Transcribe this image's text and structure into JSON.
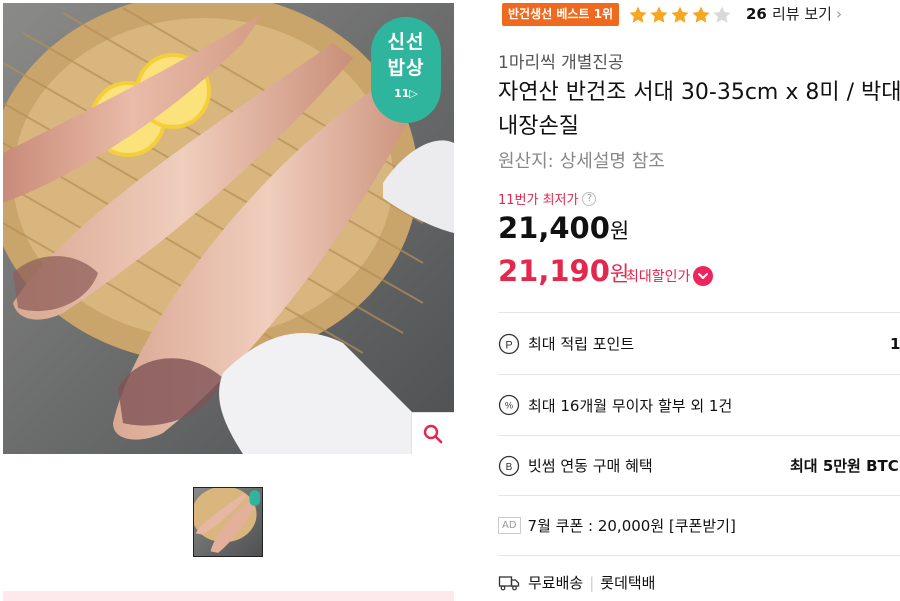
{
  "gallery": {
    "badge_line1": "신선",
    "badge_line2": "밥상",
    "badge_logo": "11▷",
    "zoom_icon": "search-icon"
  },
  "header": {
    "best_badge": "반건생선 베스트 1위",
    "rating": 4,
    "rating_max": 5,
    "review_count": "26",
    "review_link": "리뷰 보기",
    "star_color": "#f5a623"
  },
  "product": {
    "subtitle": "1마리씩 개별진공",
    "title": "자연산 반건조 서대 30-35cm x 8미 / 박대 / 내장손질",
    "origin_label": "원산지:",
    "origin_value": "상세설명 참조"
  },
  "price": {
    "lowest_label": "11번가 최저가",
    "original": "21,400",
    "original_unit": "원",
    "sale": "21,190",
    "sale_unit": "원",
    "max_discount_label": "최대할인가",
    "accent_color": "#e4274c"
  },
  "benefits": [
    {
      "icon": "point-icon",
      "label": "최대 적립 포인트",
      "value": "1"
    },
    {
      "icon": "percent-icon",
      "label": "최대 16개월 무이자 할부 외 1건",
      "value": ""
    },
    {
      "icon": "bitcoin-icon",
      "label": "빗썸 연동 구매 혜택",
      "value": "최대 5만원 BTC"
    },
    {
      "icon": "ad-tag",
      "ad_label": "AD",
      "label": "7월 쿠폰 : 20,000원 [쿠폰받기]",
      "value": ""
    },
    {
      "icon": "truck-icon",
      "label": "무료배송",
      "value": "롯데택배"
    }
  ]
}
